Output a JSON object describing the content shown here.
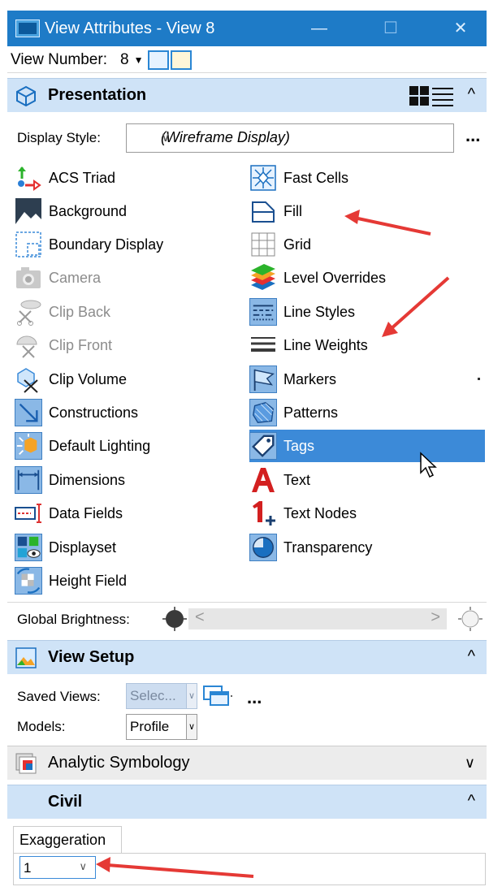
{
  "window": {
    "title": "View Attributes - View 8",
    "minimize": "—",
    "maximize": "☐",
    "close": "✕"
  },
  "view_number": {
    "label": "View Number:",
    "value": "8"
  },
  "presentation": {
    "title": "Presentation",
    "display_style": {
      "label": "Display Style:",
      "value": "(Wireframe Display)",
      "more": "..."
    },
    "left_items": [
      "ACS Triad",
      "Background",
      "Boundary Display",
      "Camera",
      "Clip Back",
      "Clip Front",
      "Clip Volume",
      "Constructions",
      "Default Lighting",
      "Dimensions",
      "Data Fields",
      "Displayset",
      "Height Field"
    ],
    "right_items": [
      "Fast Cells",
      "Fill",
      "Grid",
      "Level Overrides",
      "Line Styles",
      "Line Weights",
      "Markers",
      "Patterns",
      "Tags",
      "Text",
      "Text Nodes",
      "Transparency"
    ],
    "global_brightness_label": "Global Brightness:"
  },
  "view_setup": {
    "title": "View Setup",
    "saved_views_label": "Saved Views:",
    "saved_views_value": "Selec...",
    "models_label": "Models:",
    "models_value": "Profile",
    "more": "..."
  },
  "analytic_symbology": {
    "title": "Analytic Symbology"
  },
  "civil": {
    "title": "Civil",
    "tab": "Exaggeration",
    "exaggeration_value": "1"
  },
  "colors": {
    "title_bar": "#1e7bc7",
    "section_header": "#cfe3f7",
    "selected_row": "#3c8ad8",
    "annotation_arrow": "#e53935"
  }
}
